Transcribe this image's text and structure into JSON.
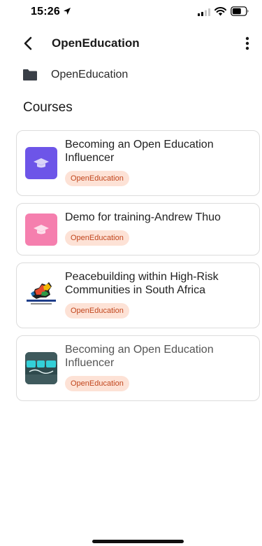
{
  "status_bar": {
    "time": "15:26"
  },
  "app_bar": {
    "title": "OpenEducation"
  },
  "folder": {
    "label": "OpenEducation"
  },
  "section": {
    "title": "Courses"
  },
  "courses": [
    {
      "title": "Becoming an Open Education Influencer",
      "tag": "OpenEducation",
      "thumb": "graduation-cap-icon",
      "thumb_color": "#6d55e8"
    },
    {
      "title": "Demo for training-Andrew Thuo",
      "tag": "OpenEducation",
      "thumb": "graduation-cap-icon",
      "thumb_color": "#f57fae"
    },
    {
      "title": "Peacebuilding within High-Risk Communities in South Africa",
      "tag": "OpenEducation",
      "thumb": "peacebuilding-logo"
    },
    {
      "title": "Becoming an Open Education Influencer",
      "tag": "OpenEducation",
      "thumb": "open-education-logo"
    }
  ],
  "colors": {
    "tag_bg": "#fde2d6",
    "tag_text": "#c1461d",
    "card_border": "#dcdcdc"
  }
}
